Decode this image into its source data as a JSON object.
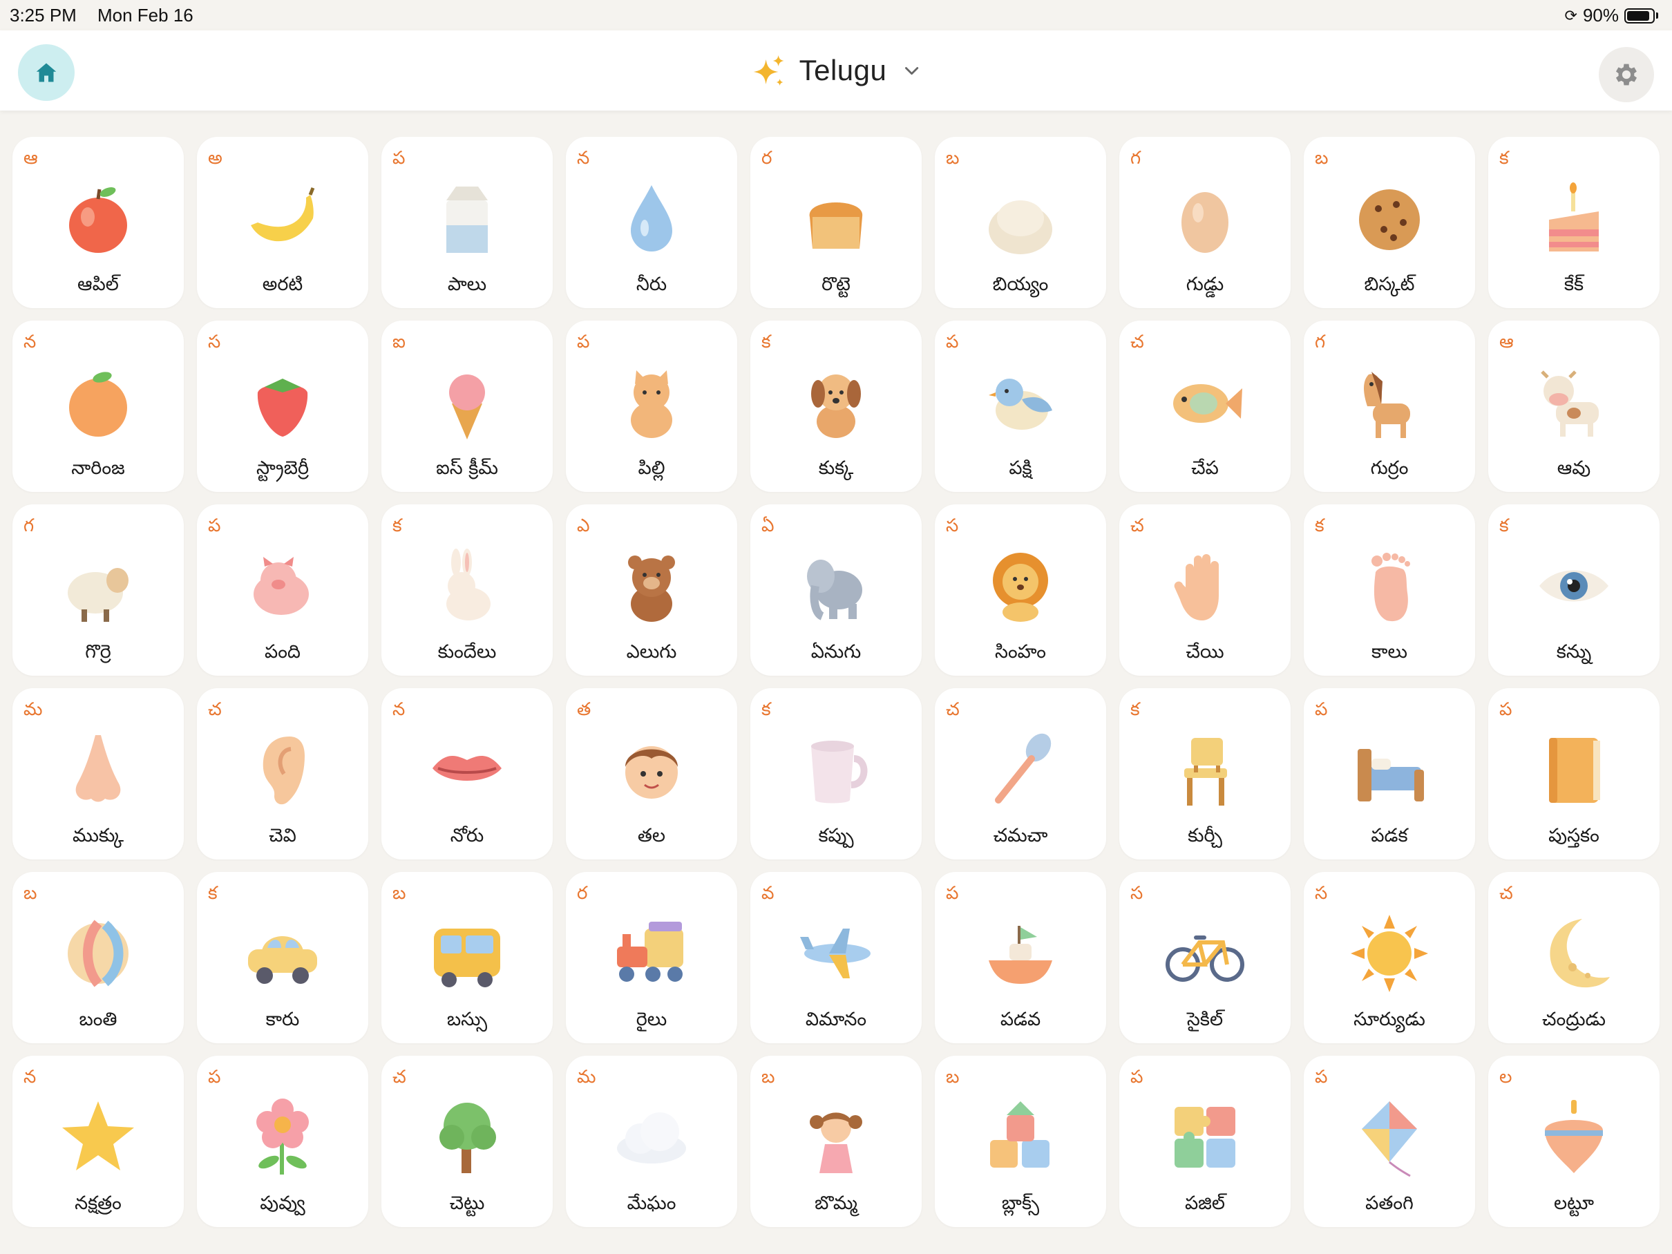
{
  "status_bar": {
    "time": "3:25 PM",
    "date": "Mon Feb 16",
    "battery": "90%",
    "battery_level": 0.9
  },
  "header": {
    "title": "Telugu",
    "home_icon": "home-icon",
    "settings_icon": "gear-icon",
    "sparkle_icon": "sparkle-icon"
  },
  "colors": {
    "letter": "#e8762f",
    "home_bg": "#cdeef0",
    "home_icon": "#1f8a96",
    "sparkle": "#f3b52e",
    "page_bg": "#f5f3ef"
  },
  "cards": [
    {
      "letter": "ఆ",
      "word": "ఆపిల్",
      "icon": "apple"
    },
    {
      "letter": "అ",
      "word": "అరటి",
      "icon": "banana"
    },
    {
      "letter": "ప",
      "word": "పాలు",
      "icon": "milk"
    },
    {
      "letter": "న",
      "word": "నీరు",
      "icon": "water"
    },
    {
      "letter": "ర",
      "word": "రొట్టె",
      "icon": "bread"
    },
    {
      "letter": "బ",
      "word": "బియ్యం",
      "icon": "rice"
    },
    {
      "letter": "గ",
      "word": "గుడ్డు",
      "icon": "egg"
    },
    {
      "letter": "బ",
      "word": "బిస్కట్",
      "icon": "cookie"
    },
    {
      "letter": "క",
      "word": "కేక్",
      "icon": "cake"
    },
    {
      "letter": "న",
      "word": "నారింజ",
      "icon": "orange"
    },
    {
      "letter": "స",
      "word": "స్ట్రాబెర్రీ",
      "icon": "strawberry"
    },
    {
      "letter": "ఐ",
      "word": "ఐస్ క్రీమ్",
      "icon": "ice-cream"
    },
    {
      "letter": "ప",
      "word": "పిల్లి",
      "icon": "cat"
    },
    {
      "letter": "క",
      "word": "కుక్క",
      "icon": "dog"
    },
    {
      "letter": "ప",
      "word": "పక్షి",
      "icon": "bird"
    },
    {
      "letter": "చ",
      "word": "చేప",
      "icon": "fish"
    },
    {
      "letter": "గ",
      "word": "గుర్రం",
      "icon": "horse"
    },
    {
      "letter": "ఆ",
      "word": "ఆవు",
      "icon": "cow"
    },
    {
      "letter": "గ",
      "word": "గొర్రె",
      "icon": "sheep"
    },
    {
      "letter": "ప",
      "word": "పంది",
      "icon": "pig"
    },
    {
      "letter": "క",
      "word": "కుందేలు",
      "icon": "rabbit"
    },
    {
      "letter": "ఎ",
      "word": "ఎలుగు",
      "icon": "bear"
    },
    {
      "letter": "ఏ",
      "word": "ఏనుగు",
      "icon": "elephant"
    },
    {
      "letter": "స",
      "word": "సింహం",
      "icon": "lion"
    },
    {
      "letter": "చ",
      "word": "చేయి",
      "icon": "hand"
    },
    {
      "letter": "క",
      "word": "కాలు",
      "icon": "foot"
    },
    {
      "letter": "క",
      "word": "కన్ను",
      "icon": "eye"
    },
    {
      "letter": "మ",
      "word": "ముక్కు",
      "icon": "nose"
    },
    {
      "letter": "చ",
      "word": "చెవి",
      "icon": "ear"
    },
    {
      "letter": "న",
      "word": "నోరు",
      "icon": "mouth"
    },
    {
      "letter": "త",
      "word": "తల",
      "icon": "head"
    },
    {
      "letter": "క",
      "word": "కప్పు",
      "icon": "cup"
    },
    {
      "letter": "చ",
      "word": "చమచా",
      "icon": "spoon"
    },
    {
      "letter": "క",
      "word": "కుర్చీ",
      "icon": "chair"
    },
    {
      "letter": "ప",
      "word": "పడక",
      "icon": "bed"
    },
    {
      "letter": "ప",
      "word": "పుస్తకం",
      "icon": "book"
    },
    {
      "letter": "బ",
      "word": "బంతి",
      "icon": "ball"
    },
    {
      "letter": "క",
      "word": "కారు",
      "icon": "car"
    },
    {
      "letter": "బ",
      "word": "బస్సు",
      "icon": "bus"
    },
    {
      "letter": "ర",
      "word": "రైలు",
      "icon": "train"
    },
    {
      "letter": "వ",
      "word": "విమానం",
      "icon": "airplane"
    },
    {
      "letter": "ప",
      "word": "పడవ",
      "icon": "boat"
    },
    {
      "letter": "స",
      "word": "సైకిల్",
      "icon": "bicycle"
    },
    {
      "letter": "స",
      "word": "సూర్యుడు",
      "icon": "sun"
    },
    {
      "letter": "చ",
      "word": "చంద్రుడు",
      "icon": "moon"
    },
    {
      "letter": "న",
      "word": "నక్షత్రం",
      "icon": "star"
    },
    {
      "letter": "ప",
      "word": "పువ్వు",
      "icon": "flower"
    },
    {
      "letter": "చ",
      "word": "చెట్టు",
      "icon": "tree"
    },
    {
      "letter": "మ",
      "word": "మేఘం",
      "icon": "cloud"
    },
    {
      "letter": "బ",
      "word": "బొమ్మ",
      "icon": "doll"
    },
    {
      "letter": "బ",
      "word": "బ్లాక్స్",
      "icon": "blocks"
    },
    {
      "letter": "ప",
      "word": "పజిల్",
      "icon": "puzzle"
    },
    {
      "letter": "ప",
      "word": "పతంగి",
      "icon": "kite"
    },
    {
      "letter": "ల",
      "word": "లట్టూ",
      "icon": "spinning-top"
    }
  ]
}
